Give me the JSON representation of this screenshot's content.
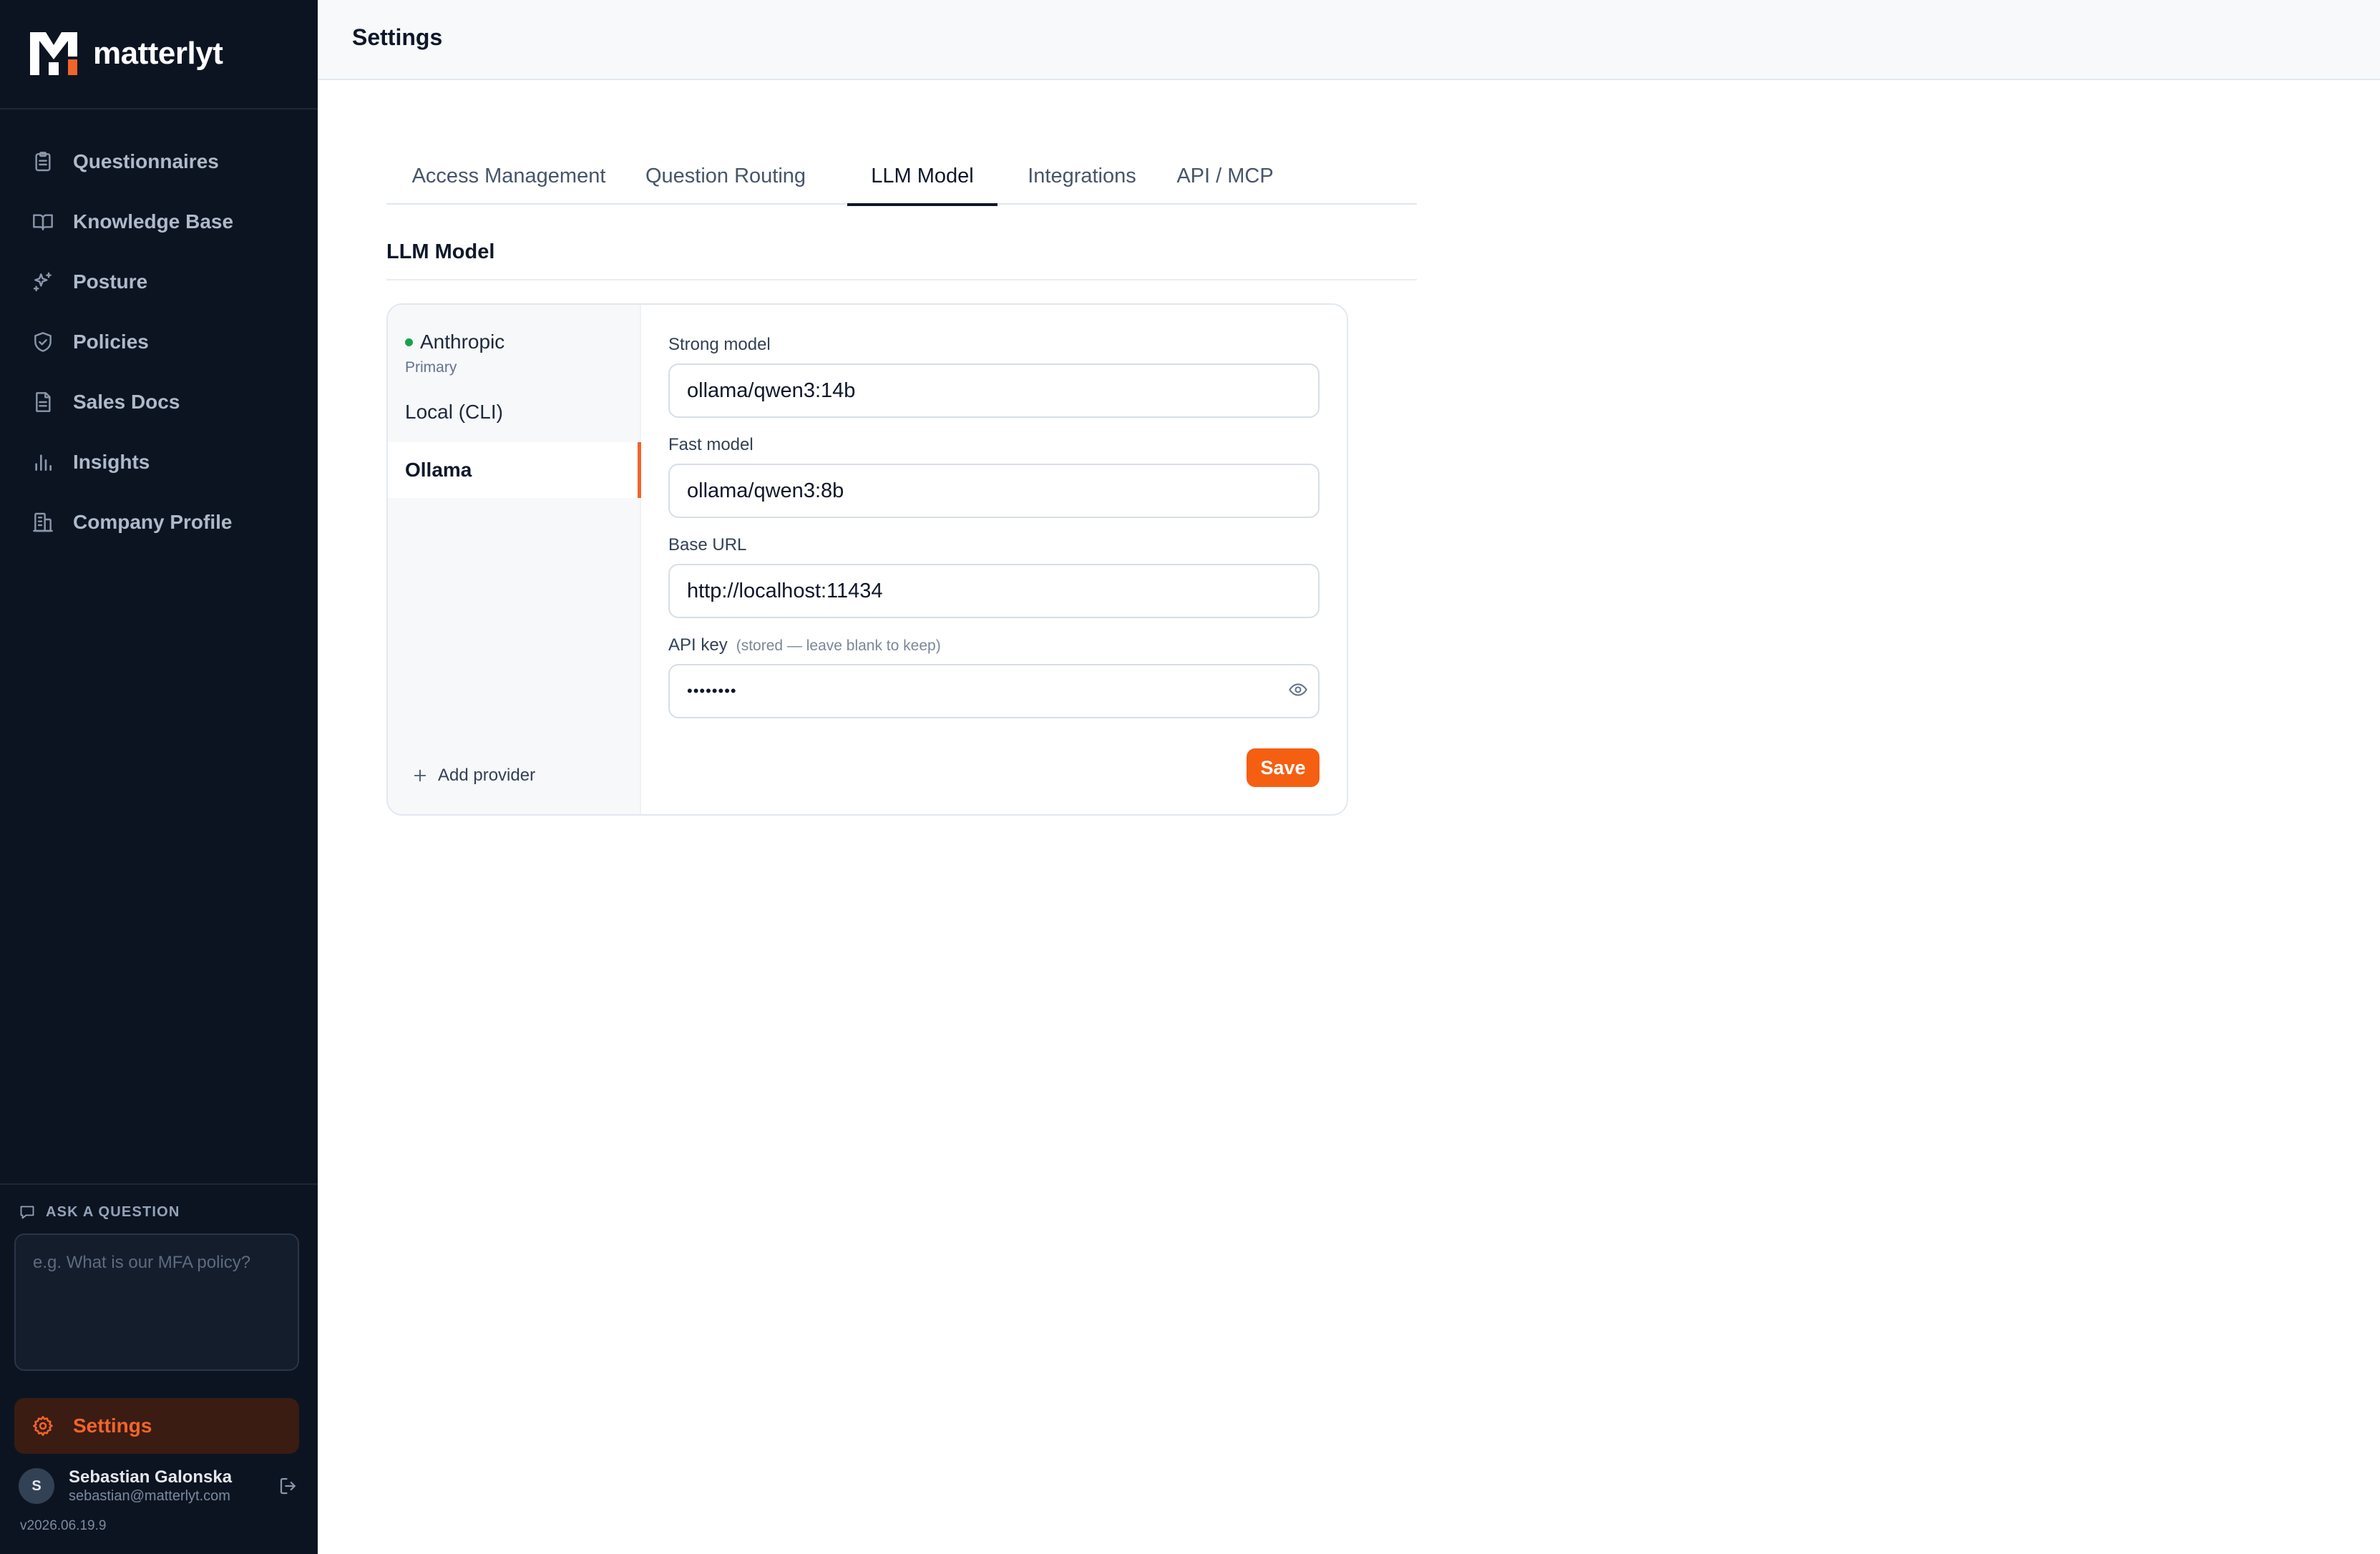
{
  "brand": {
    "name": "matterlyt",
    "accent": "#f2642a"
  },
  "sidebar": {
    "items": [
      {
        "label": "Questionnaires",
        "icon": "clipboard-icon"
      },
      {
        "label": "Knowledge Base",
        "icon": "book-icon"
      },
      {
        "label": "Posture",
        "icon": "sparkles-icon"
      },
      {
        "label": "Policies",
        "icon": "shield-icon"
      },
      {
        "label": "Sales Docs",
        "icon": "document-icon"
      },
      {
        "label": "Insights",
        "icon": "bar-chart-icon"
      },
      {
        "label": "Company Profile",
        "icon": "building-icon"
      }
    ],
    "ask": {
      "title": "ASK A QUESTION",
      "placeholder": "e.g. What is our MFA policy?"
    },
    "settings_label": "Settings",
    "user": {
      "initial": "S",
      "name": "Sebastian Galonska",
      "email": "sebastian@matterlyt.com"
    },
    "version": "v2026.06.19.9"
  },
  "header": {
    "title": "Settings"
  },
  "tabs": [
    {
      "label": "Access Management",
      "active": false
    },
    {
      "label": "Question Routing",
      "active": false
    },
    {
      "label": "LLM Model",
      "active": true
    },
    {
      "label": "Integrations",
      "active": false
    },
    {
      "label": "API / MCP",
      "active": false
    }
  ],
  "section": {
    "title": "LLM Model"
  },
  "providers": {
    "anthropic": {
      "name": "Anthropic",
      "sub": "Primary",
      "status_color": "#16a34a"
    },
    "local": {
      "name": "Local (CLI)"
    },
    "ollama": {
      "name": "Ollama",
      "selected": true
    },
    "add_label": "Add provider"
  },
  "form": {
    "strong_label": "Strong model",
    "strong_value": "ollama/qwen3:14b",
    "fast_label": "Fast model",
    "fast_value": "ollama/qwen3:8b",
    "base_url_label": "Base URL",
    "base_url_value": "http://localhost:11434",
    "api_key_label": "API key",
    "api_key_hint": "(stored — leave blank to keep)",
    "api_key_value": "••••••••",
    "save_label": "Save"
  }
}
